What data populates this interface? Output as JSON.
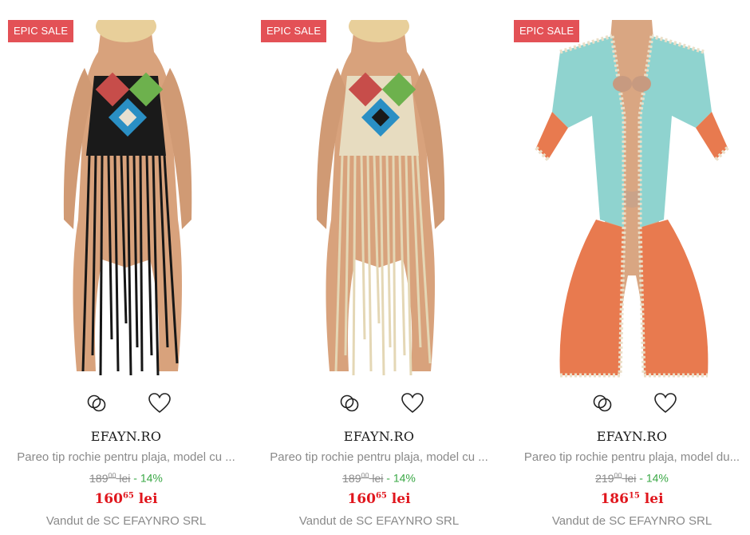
{
  "products": [
    {
      "badge": "EPIC SALE",
      "brand": "EFAYN.RO",
      "title": "Pareo tip rochie pentru plaja, model cu ...",
      "old_price_int": "189",
      "old_price_dec": "00",
      "old_price_currency": "lei",
      "discount": "- 14%",
      "price_int": "160",
      "price_dec": "65",
      "price_currency": "lei",
      "seller": "Vandut de SC EFAYNRO SRL",
      "image_icon": "fringe-crochet-dress-black-photo"
    },
    {
      "badge": "EPIC SALE",
      "brand": "EFAYN.RO",
      "title": "Pareo tip rochie pentru plaja, model cu ...",
      "old_price_int": "189",
      "old_price_dec": "00",
      "old_price_currency": "lei",
      "discount": "- 14%",
      "price_int": "160",
      "price_dec": "65",
      "price_currency": "lei",
      "seller": "Vandut de SC EFAYNRO SRL",
      "image_icon": "fringe-crochet-dress-beige-photo"
    },
    {
      "badge": "EPIC SALE",
      "brand": "EFAYN.RO",
      "title": "Pareo tip rochie pentru plaja, model du...",
      "old_price_int": "219",
      "old_price_dec": "00",
      "old_price_currency": "lei",
      "discount": "- 14%",
      "price_int": "186",
      "price_dec": "15",
      "price_currency": "lei",
      "seller": "Vandut de SC EFAYNRO SRL",
      "image_icon": "crochet-kimonopareo-photo"
    }
  ],
  "icons": {
    "compare": "compare-rings-icon",
    "wishlist": "heart-outline-icon"
  },
  "colors": {
    "badge_bg": "#e35156",
    "price_red": "#e0161d",
    "discount_green": "#3aa845",
    "muted_text": "#8a8a8a"
  }
}
